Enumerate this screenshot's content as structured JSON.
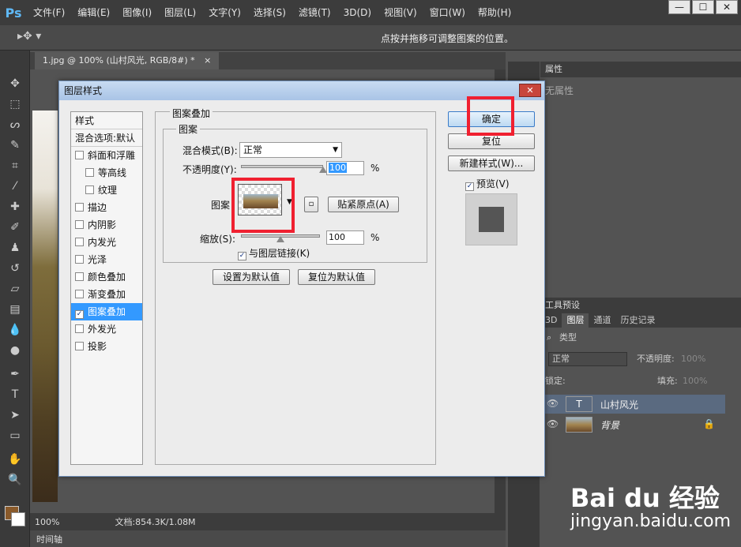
{
  "app": {
    "logo": "Ps",
    "menus": [
      "文件(F)",
      "编辑(E)",
      "图像(I)",
      "图层(L)",
      "文字(Y)",
      "选择(S)",
      "滤镜(T)",
      "3D(D)",
      "视图(V)",
      "窗口(W)",
      "帮助(H)"
    ],
    "window_buttons": [
      "—",
      "☐",
      "✕"
    ]
  },
  "options_bar": {
    "hint": "点按并拖移可调整图案的位置。"
  },
  "document": {
    "tab_title": "1.jpg @ 100% (山村风光, RGB/8#) *",
    "tab_close": "×",
    "zoom": "100%",
    "doc_info": "文档:854.3K/1.08M",
    "timeline": "时间轴"
  },
  "properties_panel": {
    "title": "属性",
    "text": "无属性"
  },
  "layers_panel": {
    "presets_title": "工具预设",
    "tabs": [
      "3D",
      "图层",
      "通道",
      "历史记录"
    ],
    "filter_label": "类型",
    "blend_mode": "正常",
    "opacity_label": "不透明度:",
    "opacity_value": "100%",
    "lock_label": "锁定:",
    "fill_label": "填充:",
    "fill_value": "100%",
    "layers": [
      {
        "name": "山村风光",
        "type_glyph": "T"
      },
      {
        "name": "背景"
      }
    ]
  },
  "dialog": {
    "title": "图层样式",
    "close": "✕",
    "styles_header": "样式",
    "blend_options": "混合选项:默认",
    "style_items": [
      {
        "label": "斜面和浮雕",
        "checked": false
      },
      {
        "label": "等高线",
        "checked": false,
        "indent": true
      },
      {
        "label": "纹理",
        "checked": false,
        "indent": true
      },
      {
        "label": "描边",
        "checked": false
      },
      {
        "label": "内阴影",
        "checked": false
      },
      {
        "label": "内发光",
        "checked": false
      },
      {
        "label": "光泽",
        "checked": false
      },
      {
        "label": "颜色叠加",
        "checked": false
      },
      {
        "label": "渐变叠加",
        "checked": false
      },
      {
        "label": "图案叠加",
        "checked": true,
        "active": true
      },
      {
        "label": "外发光",
        "checked": false
      },
      {
        "label": "投影",
        "checked": false
      }
    ],
    "section_title": "图案叠加",
    "subsection_title": "图案",
    "blend_mode_label": "混合模式(B):",
    "blend_mode_value": "正常",
    "opacity_label": "不透明度(Y):",
    "opacity_value": "100",
    "percent": "%",
    "opacity_level": 1.0,
    "pattern_label": "图案",
    "snap_origin": "贴紧原点(A)",
    "scale_label": "缩放(S):",
    "scale_value": "100",
    "scale_level": 0.5,
    "link_label": "与图层链接(K)",
    "link_checked": true,
    "set_default": "设置为默认值",
    "reset_default": "复位为默认值",
    "ok": "确定",
    "reset": "复位",
    "new_style": "新建样式(W)...",
    "preview_label": "预览(V)",
    "preview_checked": true
  },
  "watermark": {
    "logo_text": "Bai du 经验",
    "url": "jingyan.baidu.com"
  },
  "colors": {
    "accent": "#3399ff",
    "highlight": "#f02030",
    "foreground_swatch": "#8a5a2a"
  }
}
